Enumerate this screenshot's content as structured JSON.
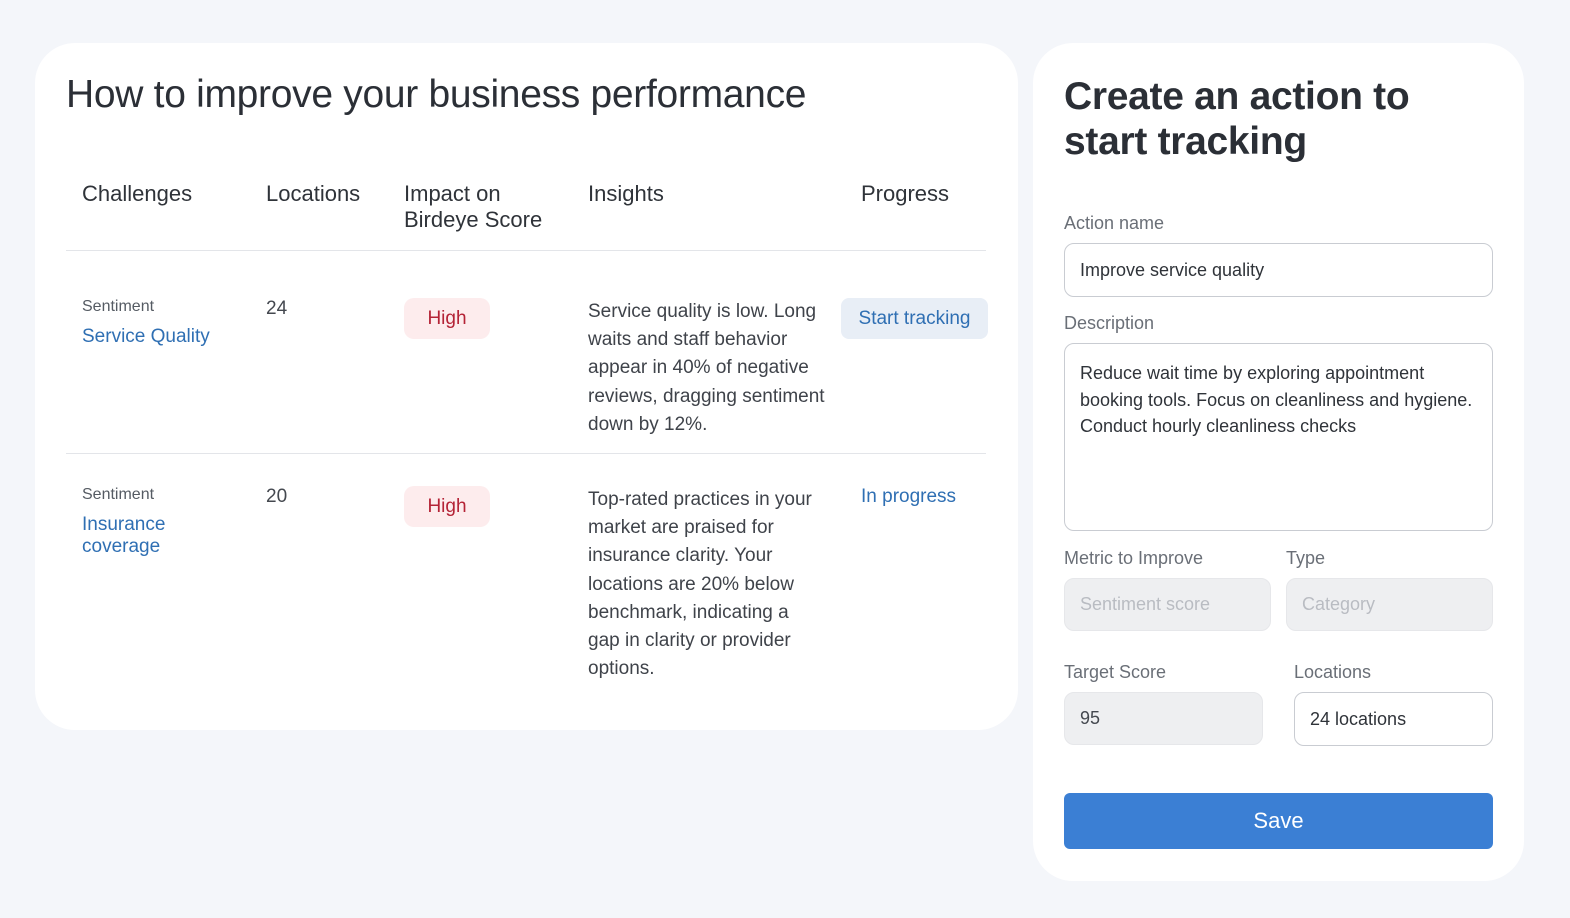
{
  "insights_panel": {
    "title": "How to improve your business performance",
    "columns": [
      "Challenges",
      "Locations",
      "Impact on Birdeye Score",
      "Insights",
      "Progress"
    ],
    "rows": [
      {
        "category": "Sentiment",
        "challenge": "Service Quality",
        "locations": "24",
        "impact": "High",
        "insight": "Service quality is low. Long waits and staff behavior appear in 40% of negative reviews, dragging sentiment down by 12%.",
        "progress": "Start tracking"
      },
      {
        "category": "Sentiment",
        "challenge": "Insurance coverage",
        "locations": "20",
        "impact": "High",
        "insight": "Top-rated practices in your market are praised for insurance clarity. Your locations are 20% below benchmark, indicating a gap in clarity or provider options.",
        "progress": "In progress"
      }
    ]
  },
  "action_form": {
    "title": "Create an action to start tracking",
    "action_name_label": "Action name",
    "action_name_value": "Improve service quality",
    "description_label": "Description",
    "description_value": "Reduce wait time by exploring appointment booking tools. Focus on cleanliness and hygiene. Conduct hourly cleanliness checks",
    "metric_label": "Metric to Improve",
    "metric_placeholder": "Sentiment score",
    "type_label": "Type",
    "type_placeholder": "Category",
    "target_score_label": "Target Score",
    "target_score_value": "95",
    "locations_label": "Locations",
    "locations_value": "24 locations",
    "save_label": "Save"
  },
  "colors": {
    "accent": "#3b7fd4",
    "link": "#2f6fb3",
    "badge_high_bg": "#fdeced",
    "badge_high_text": "#b42336",
    "page_bg": "#f4f6fa"
  }
}
